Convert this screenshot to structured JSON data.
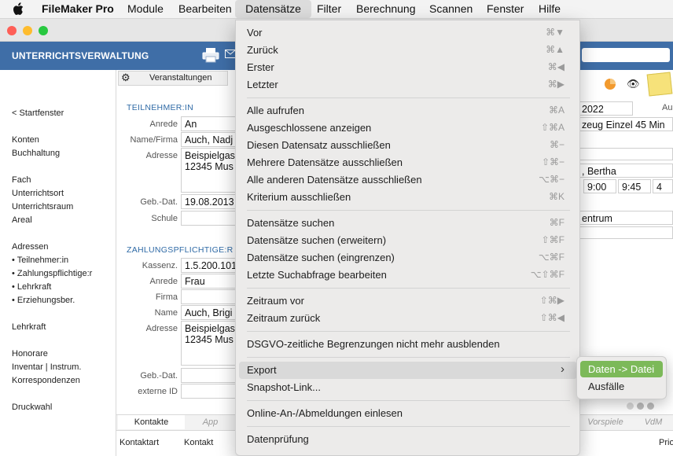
{
  "menubar": {
    "app": "FileMaker Pro",
    "items": [
      "Module",
      "Bearbeiten",
      "Datensätze",
      "Filter",
      "Berechnung",
      "Scannen",
      "Fenster",
      "Hilfe"
    ],
    "active": "Datensätze"
  },
  "header": {
    "title": "UNTERRICHTSVERWALTUNG"
  },
  "sidebar": {
    "items": [
      "< Startfenster",
      "Konten",
      "Buchhaltung",
      "Fach",
      "Unterrichtsort",
      "Unterrichtsraum",
      "Areal",
      "Adressen",
      "• Teilnehmer:in",
      "• Zahlungspflichtige:r",
      "• Lehrkraft",
      "• Erziehungsber.",
      "Lehrkraft",
      "Honorare",
      "Inventar | Instrum.",
      "Korrespondenzen",
      "Druckwahl"
    ]
  },
  "form": {
    "tab_top": "Veranstaltungen",
    "section1": "TEILNEHMER:IN",
    "section2": "ZAHLUNGSPFLICHTIGE:R",
    "labels": {
      "anrede": "Anrede",
      "name": "Name/Firma",
      "adresse": "Adresse",
      "geb": "Geb.-Dat.",
      "schule": "Schule",
      "kassenz": "Kassenz.",
      "anrede2": "Anrede",
      "firma": "Firma",
      "name2": "Name",
      "adresse2": "Adresse",
      "geb2": "Geb.-Dat.",
      "extern": "externe ID"
    },
    "values": {
      "anrede": "An",
      "name": "Auch, Nadj",
      "adresse_l1": "Beispielgas",
      "adresse_l2": "12345 Mus",
      "geb": "19.08.2013",
      "kassenz": "1.5.200.101",
      "anrede2": "Frau",
      "name2": "Auch, Brigi",
      "adresse2_l1": "Beispielgas",
      "adresse2_l2": "12345 Mus"
    },
    "right": {
      "year": "2022",
      "aus": "Aus",
      "course": "zeug Einzel 45 Min",
      "teacher": ", Bertha",
      "t1": "9:00",
      "t2": "9:45",
      "t3": "4",
      "place": "entrum"
    },
    "bottom_tabs": [
      "Kontakte",
      "App",
      "Vorspiele",
      "VdM"
    ],
    "bottom_cols": [
      "Kontaktart",
      "Kontakt",
      "Prio"
    ]
  },
  "menu": {
    "groups": [
      [
        {
          "t": "Vor",
          "k": "⌘▼"
        },
        {
          "t": "Zurück",
          "k": "⌘▲"
        },
        {
          "t": "Erster",
          "k": "⌘◀"
        },
        {
          "t": "Letzter",
          "k": "⌘▶"
        }
      ],
      [
        {
          "t": "Alle aufrufen",
          "k": "⌘A"
        },
        {
          "t": "Ausgeschlossene anzeigen",
          "k": "⇧⌘A"
        },
        {
          "t": "Diesen Datensatz ausschließen",
          "k": "⌘−"
        },
        {
          "t": "Mehrere Datensätze ausschließen",
          "k": "⇧⌘−"
        },
        {
          "t": "Alle anderen Datensätze ausschließen",
          "k": "⌥⌘−"
        },
        {
          "t": "Kriterium ausschließen",
          "k": "⌘K"
        }
      ],
      [
        {
          "t": "Datensätze suchen",
          "k": "⌘F"
        },
        {
          "t": "Datensätze suchen (erweitern)",
          "k": "⇧⌘F"
        },
        {
          "t": "Datensätze suchen (eingrenzen)",
          "k": "⌥⌘F"
        },
        {
          "t": "Letzte Suchabfrage bearbeiten",
          "k": "⌥⇧⌘F"
        }
      ],
      [
        {
          "t": "Zeitraum vor",
          "k": "⇧⌘▶"
        },
        {
          "t": "Zeitraum zurück",
          "k": "⇧⌘◀"
        }
      ],
      [
        {
          "t": "DSGVO-zeitliche Begrenzungen nicht mehr ausblenden",
          "k": ""
        }
      ],
      [
        {
          "t": "Export",
          "k": "›",
          "hl": true
        },
        {
          "t": "Snapshot-Link...",
          "k": ""
        }
      ],
      [
        {
          "t": "Online-An-/Abmeldungen einlesen",
          "k": ""
        }
      ],
      [
        {
          "t": "Datenprüfung",
          "k": ""
        }
      ]
    ],
    "submenu": [
      {
        "t": "Daten -> Datei",
        "sel": true
      },
      {
        "t": "Ausfälle",
        "sel": false
      }
    ]
  },
  "colors": {
    "header": "#3f6ea7",
    "highlight": "#7cb959",
    "accent_text": "#2f6aa6"
  }
}
